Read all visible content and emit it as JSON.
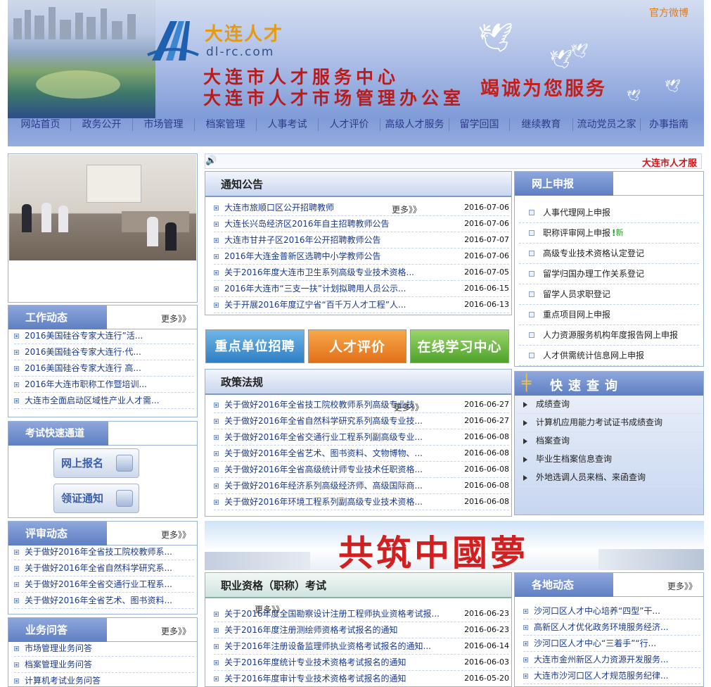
{
  "header": {
    "brand_cn": "大连人才",
    "brand_url": "dl-rc.com",
    "org_line1": "大连市人才服务中心",
    "org_line2": "大连市人才市场管理办公室",
    "slogan": "竭诚为您服务",
    "weibo": "官方微博"
  },
  "nav": [
    "网站首页",
    "政务公开",
    "市场管理",
    "档案管理",
    "人事考试",
    "人才评价",
    "高级人才服务",
    "留学回国",
    "继续教育",
    "流动党员之家",
    "办事指南"
  ],
  "ticker": "大连市人才服",
  "notice": {
    "title": "通知公告",
    "more": "更多》》",
    "items": [
      {
        "text": "大连市旅顺口区公开招聘教师",
        "date": "2016-07-06"
      },
      {
        "text": "大连长兴岛经济区2016年自主招聘教师公告",
        "date": "2016-07-06"
      },
      {
        "text": "大连市甘井子区2016年公开招聘教师公告",
        "date": "2016-07-07"
      },
      {
        "text": "2016年大连金普新区选聘中小学教师公告",
        "date": "2016-07-06"
      },
      {
        "text": "关于2016年度大连市卫生系列高级专业技术资格...",
        "date": "2016-07-05"
      },
      {
        "text": "2016年大连市“三支一扶”计划拟聘用人员公示...",
        "date": "2016-06-15"
      },
      {
        "text": "关于开展2016年度辽宁省“百千万人才工程”人...",
        "date": "2016-06-13"
      }
    ]
  },
  "online": {
    "title": "网上申报",
    "new_badge": "新",
    "items": [
      "人事代理网上申报",
      "职称评审网上申报",
      "高级专业技术资格认定登记",
      "留学归国办理工作关系登记",
      "留学人员求职登记",
      "重点项目网上申报",
      "人力资源服务机构年度报告网上申报",
      "人才供需统计信息网上申报"
    ]
  },
  "work": {
    "title": "工作动态",
    "more": "更多》》",
    "items": [
      "2016美国硅谷专家大连行”活...",
      "2016美国硅谷专家大连行·代...",
      "2016美国硅谷专家大连行 高...",
      "2016年大连市职称工作暨培训...",
      "大连市全面启动区域性产业人才需..."
    ]
  },
  "banners": [
    "重点单位招聘",
    "人才评价",
    "在线学习中心"
  ],
  "policy": {
    "title": "政策法规",
    "more": "更多》》",
    "items": [
      {
        "text": "关于做好2016年全省技工院校教师系列高级专业技",
        "date": "2016-06-27"
      },
      {
        "text": "关于做好2016年全省自然科学研究系列高级专业技...",
        "date": "2016-06-27"
      },
      {
        "text": "关于做好2016年全省交通行业工程系列副高级专业...",
        "date": "2016-06-08"
      },
      {
        "text": "关于做好2016年全省艺术、图书资料、文物博物、...",
        "date": "2016-06-08"
      },
      {
        "text": "关于做好2016年全省高级统计师专业技术任职资格...",
        "date": "2016-06-08"
      },
      {
        "text": "关于做好2016年经济系列高级经济师、高级国际商...",
        "date": "2016-06-08"
      },
      {
        "text": "关于做好2016年环境工程系列副高级专业技术资格...",
        "date": "2016-06-08"
      }
    ]
  },
  "quick": {
    "title": "快速查询",
    "items": [
      "成绩查询",
      "计算机应用能力考试证书成绩查询",
      "档案查询",
      "毕业生档案信息查询",
      "外地选调人员来档、来函查询"
    ]
  },
  "exam": {
    "title": "考试快速通道",
    "buttons": [
      "网上报名",
      "领证通知"
    ]
  },
  "review": {
    "title": "评审动态",
    "more": "更多》》",
    "items": [
      "关于做好2016年全省技工院校教师系...",
      "关于做好2016年全省自然科学研究系...",
      "关于做好2016年全省交通行业工程系...",
      "关于做好2016年全省艺术、图书资料..."
    ]
  },
  "dream": {
    "text": "共筑中國夢"
  },
  "qual": {
    "title": "职业资格（职称）考试",
    "more": "更多》》",
    "items": [
      {
        "text": "关于2016年度全国勘察设计注册工程师执业资格考试报...",
        "date": "2016-06-23"
      },
      {
        "text": "关于2016年度注册测绘师资格考试报名的通知",
        "date": "2016-06-23"
      },
      {
        "text": "关于2016年注册设备监理师执业资格考试报名的通知...",
        "date": "2016-06-14"
      },
      {
        "text": "关于2016年度统计专业技术资格考试报名的通知",
        "date": "2016-06-03"
      },
      {
        "text": "关于2016年度审计专业技术资格考试报名的通知",
        "date": "2016-05-20"
      }
    ]
  },
  "local": {
    "title": "各地动态",
    "more": "更多》》",
    "items": [
      "沙河口区人才中心培养“四型”干...",
      "高新区人才优化政务环境服务经济...",
      "沙河口区人才中心“三着手”“行...",
      "大连市金州新区人力资源开发服务...",
      "大连市沙河口区人才规范服务纪律..."
    ]
  },
  "faq": {
    "title": "业务问答",
    "more": "更多》》",
    "items": [
      "市场管理业务问答",
      "档案管理业务问答",
      "计算机考试业务问答"
    ]
  }
}
